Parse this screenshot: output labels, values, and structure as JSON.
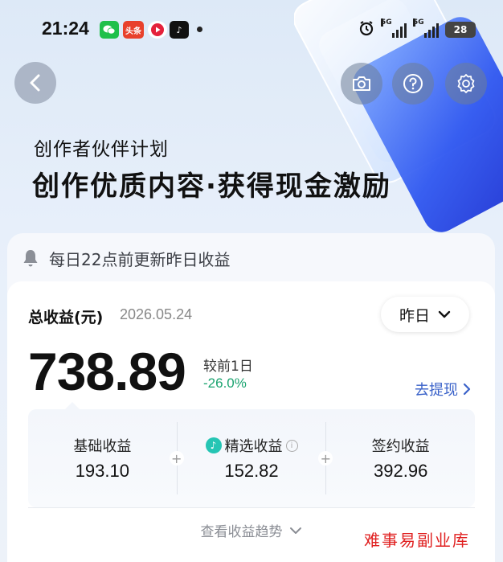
{
  "status_bar": {
    "time": "21:24",
    "toutiao_label": "头条",
    "signal1": "5G",
    "signal2": "5G",
    "battery": "28"
  },
  "header": {
    "plan_title": "创作者伙伴计划",
    "slogan": "创作优质内容·获得现金激励"
  },
  "notice": {
    "text": "每日22点前更新昨日收益"
  },
  "earnings": {
    "total_label": "总收益(元)",
    "date": "2026.05.24",
    "range_label": "昨日",
    "total_value": "738.89",
    "compare_label": "较前1日",
    "compare_value": "-26.0%",
    "withdraw_label": "去提现",
    "breakdown": [
      {
        "label": "基础收益",
        "value": "193.10"
      },
      {
        "label": "精选收益",
        "value": "152.82"
      },
      {
        "label": "签约收益",
        "value": "392.96"
      }
    ],
    "trend_label": "查看收益趋势"
  },
  "watermark": "难事易副业库",
  "colors": {
    "accent_blue": "#3a62c9",
    "negative_green": "#1aa36f",
    "watermark_red": "#e02020"
  }
}
